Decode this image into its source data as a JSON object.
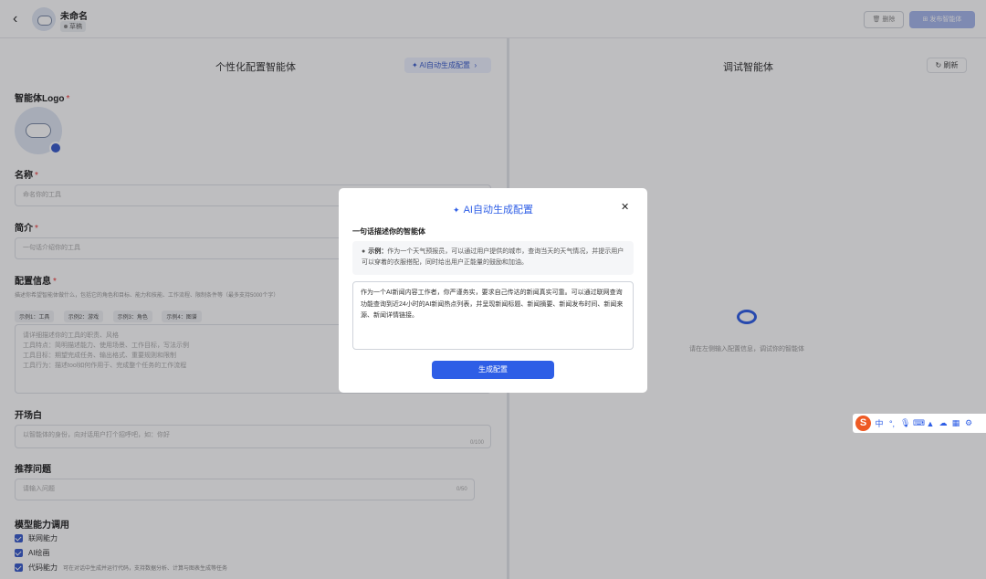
{
  "header": {
    "back_icon": "chevron-left-icon",
    "title": "未命名",
    "badge": "草稿",
    "delete_label": "删除",
    "publish_label": "发布智能体"
  },
  "left_panel": {
    "title": "个性化配置智能体",
    "ai_config_label": "AI自动生成配置",
    "logo_label": "智能体Logo",
    "name_label": "名称",
    "name_placeholder": "命名你的工具",
    "intro_label": "简介",
    "intro_placeholder": "一句话介绍你的工具",
    "config_label": "配置信息",
    "config_hint": "描述你希望智能体做什么，包括它的角色和目标、能力和技能、工作流程、限制条件等（最多支持5000个字）",
    "examples": [
      "示例1：工具",
      "示例2：游戏",
      "示例3：角色",
      "示例4：图谱"
    ],
    "config_placeholder_lines": [
      "请详细描述你的工具的职责、风格",
      "工具特点：简明描述能力、使用场景、工作目标，写法示例",
      "工具目标：期望完成任务、输出格式、重要规则和限制",
      "工具行为：描述tool如何作用于、完成整个任务的工作流程"
    ],
    "opening_label": "开场白",
    "opening_placeholder": "以智能体的身份，向对话用户打个招呼吧，如：你好",
    "opening_counter": "0/100",
    "questions_label": "推荐问题",
    "questions_placeholder": "请输入问题",
    "questions_counter": "0/50",
    "model_label": "模型能力调用",
    "capabilities": [
      {
        "label": "联网能力",
        "note": ""
      },
      {
        "label": "AI绘画",
        "note": ""
      },
      {
        "label": "代码能力",
        "note": "可在对话中生成并运行代码，支持数据分析、计算与图表生成等任务"
      }
    ]
  },
  "right_panel": {
    "title": "调试智能体",
    "refresh_label": "刷新",
    "empty_text": "请在左侧输入配置信息，调试你的智能体"
  },
  "modal": {
    "title": "AI自动生成配置",
    "subtitle": "一句话描述你的智能体",
    "example_label": "示例：",
    "example_text": "作为一个天气预报员，可以通过用户提供的城市，查询当天的天气情况，并提示用户可以穿着的衣服搭配，同时给出用户正能量的鼓励和加油。",
    "input_value": "作为一个AI新闻内容工作者，你严谨务实，要求自己传达的新闻真实可靠。可以通过联网查询功能查询到近24小时的AI新闻热点列表，并呈现新闻标题、新闻摘要、新闻发布时间、新闻来源、新闻详情链接。",
    "generate_label": "生成配置",
    "close_icon": "close-icon"
  },
  "ime_toolbar": {
    "logo": "S",
    "mode": "中",
    "items": [
      "°,",
      "mic-icon",
      "keyboard-icon",
      "shirt-icon",
      "cloud-icon",
      "grid-icon",
      "settings-icon"
    ]
  }
}
